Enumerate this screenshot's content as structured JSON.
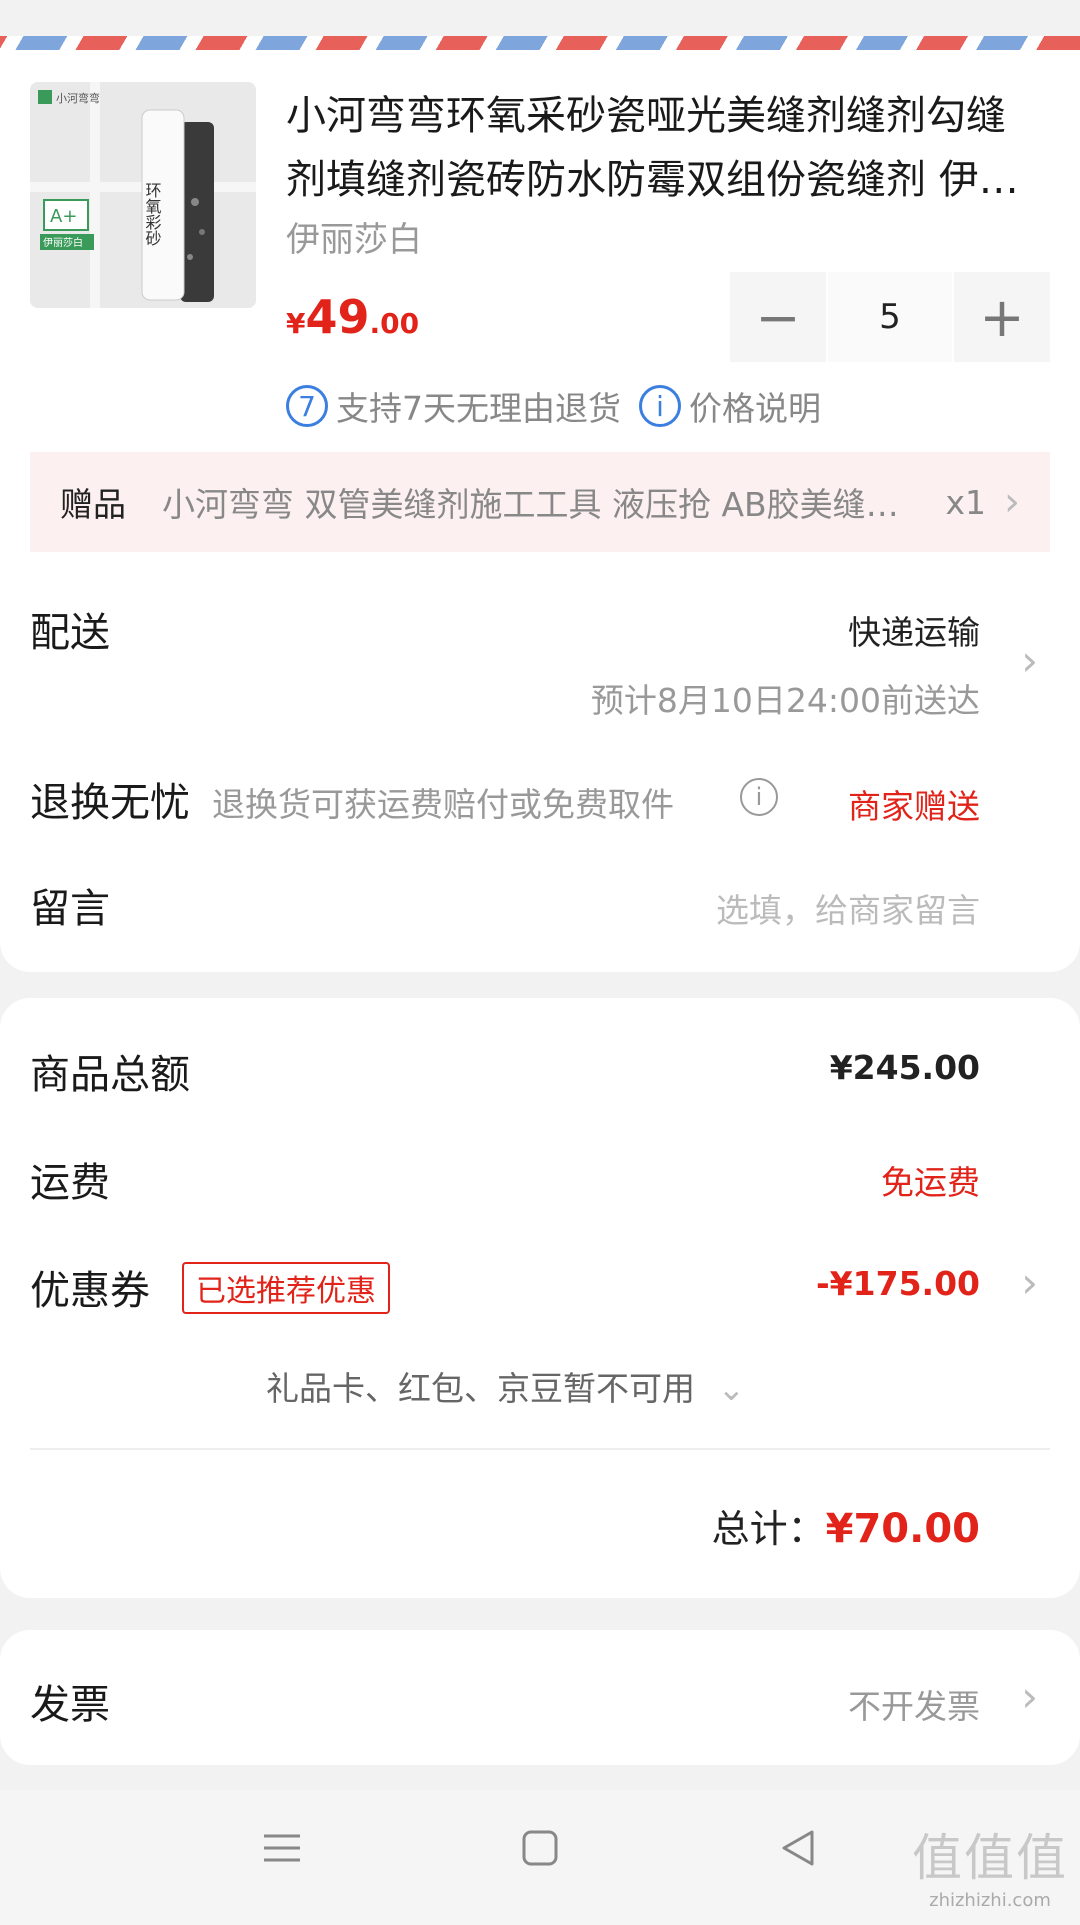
{
  "product": {
    "title_line1": "小河弯弯环氧采砂瓷哑光美缝剂缝剂勾缝",
    "title_line2": "剂填缝剂瓷砖防水防霉双组份瓷缝剂 伊丽莎白",
    "spec": "伊丽莎白",
    "price_currency": "¥",
    "price_integer": "49",
    "price_decimal": ".00",
    "quantity": "5",
    "minus_label": "−",
    "plus_label": "+",
    "thumb_text_brand": "小河弯弯",
    "thumb_text_product": "环氧彩砂",
    "thumb_text_grade": "A+",
    "thumb_text_color": "伊丽莎白",
    "service_return_icon": "7",
    "service_return": "支持7天无理由退货",
    "service_price_icon": "i",
    "service_price": "价格说明"
  },
  "gift": {
    "label": "赠品",
    "name": "小河弯弯 双管美缝剂施工工具 液压抢 AB胶美缝剂胶枪",
    "count": "x1"
  },
  "delivery": {
    "label": "配送",
    "method": "快递运输",
    "estimate": "预计8月10日24:00前送达"
  },
  "return": {
    "label": "退换无忧",
    "desc": "退换货可获运费赔付或免费取件",
    "value": "商家赠送"
  },
  "message": {
    "label": "留言",
    "placeholder": "选填，给商家留言"
  },
  "summary": {
    "goods_label": "商品总额",
    "goods_value": "¥245.00",
    "shipping_label": "运费",
    "shipping_value": "免运费",
    "coupon_label": "优惠券",
    "coupon_tag": "已选推荐优惠",
    "coupon_value": "-¥175.00",
    "unavailable": "礼品卡、红包、京豆暂不可用",
    "total_label": "总计：",
    "total_value": "¥70.00"
  },
  "invoice": {
    "label": "发票",
    "value": "不开发票"
  },
  "watermark": {
    "big": "值值值",
    "small": "zhizhizhi.com"
  },
  "colors": {
    "accent": "#e2231a",
    "info_blue": "#3b7fe0"
  }
}
